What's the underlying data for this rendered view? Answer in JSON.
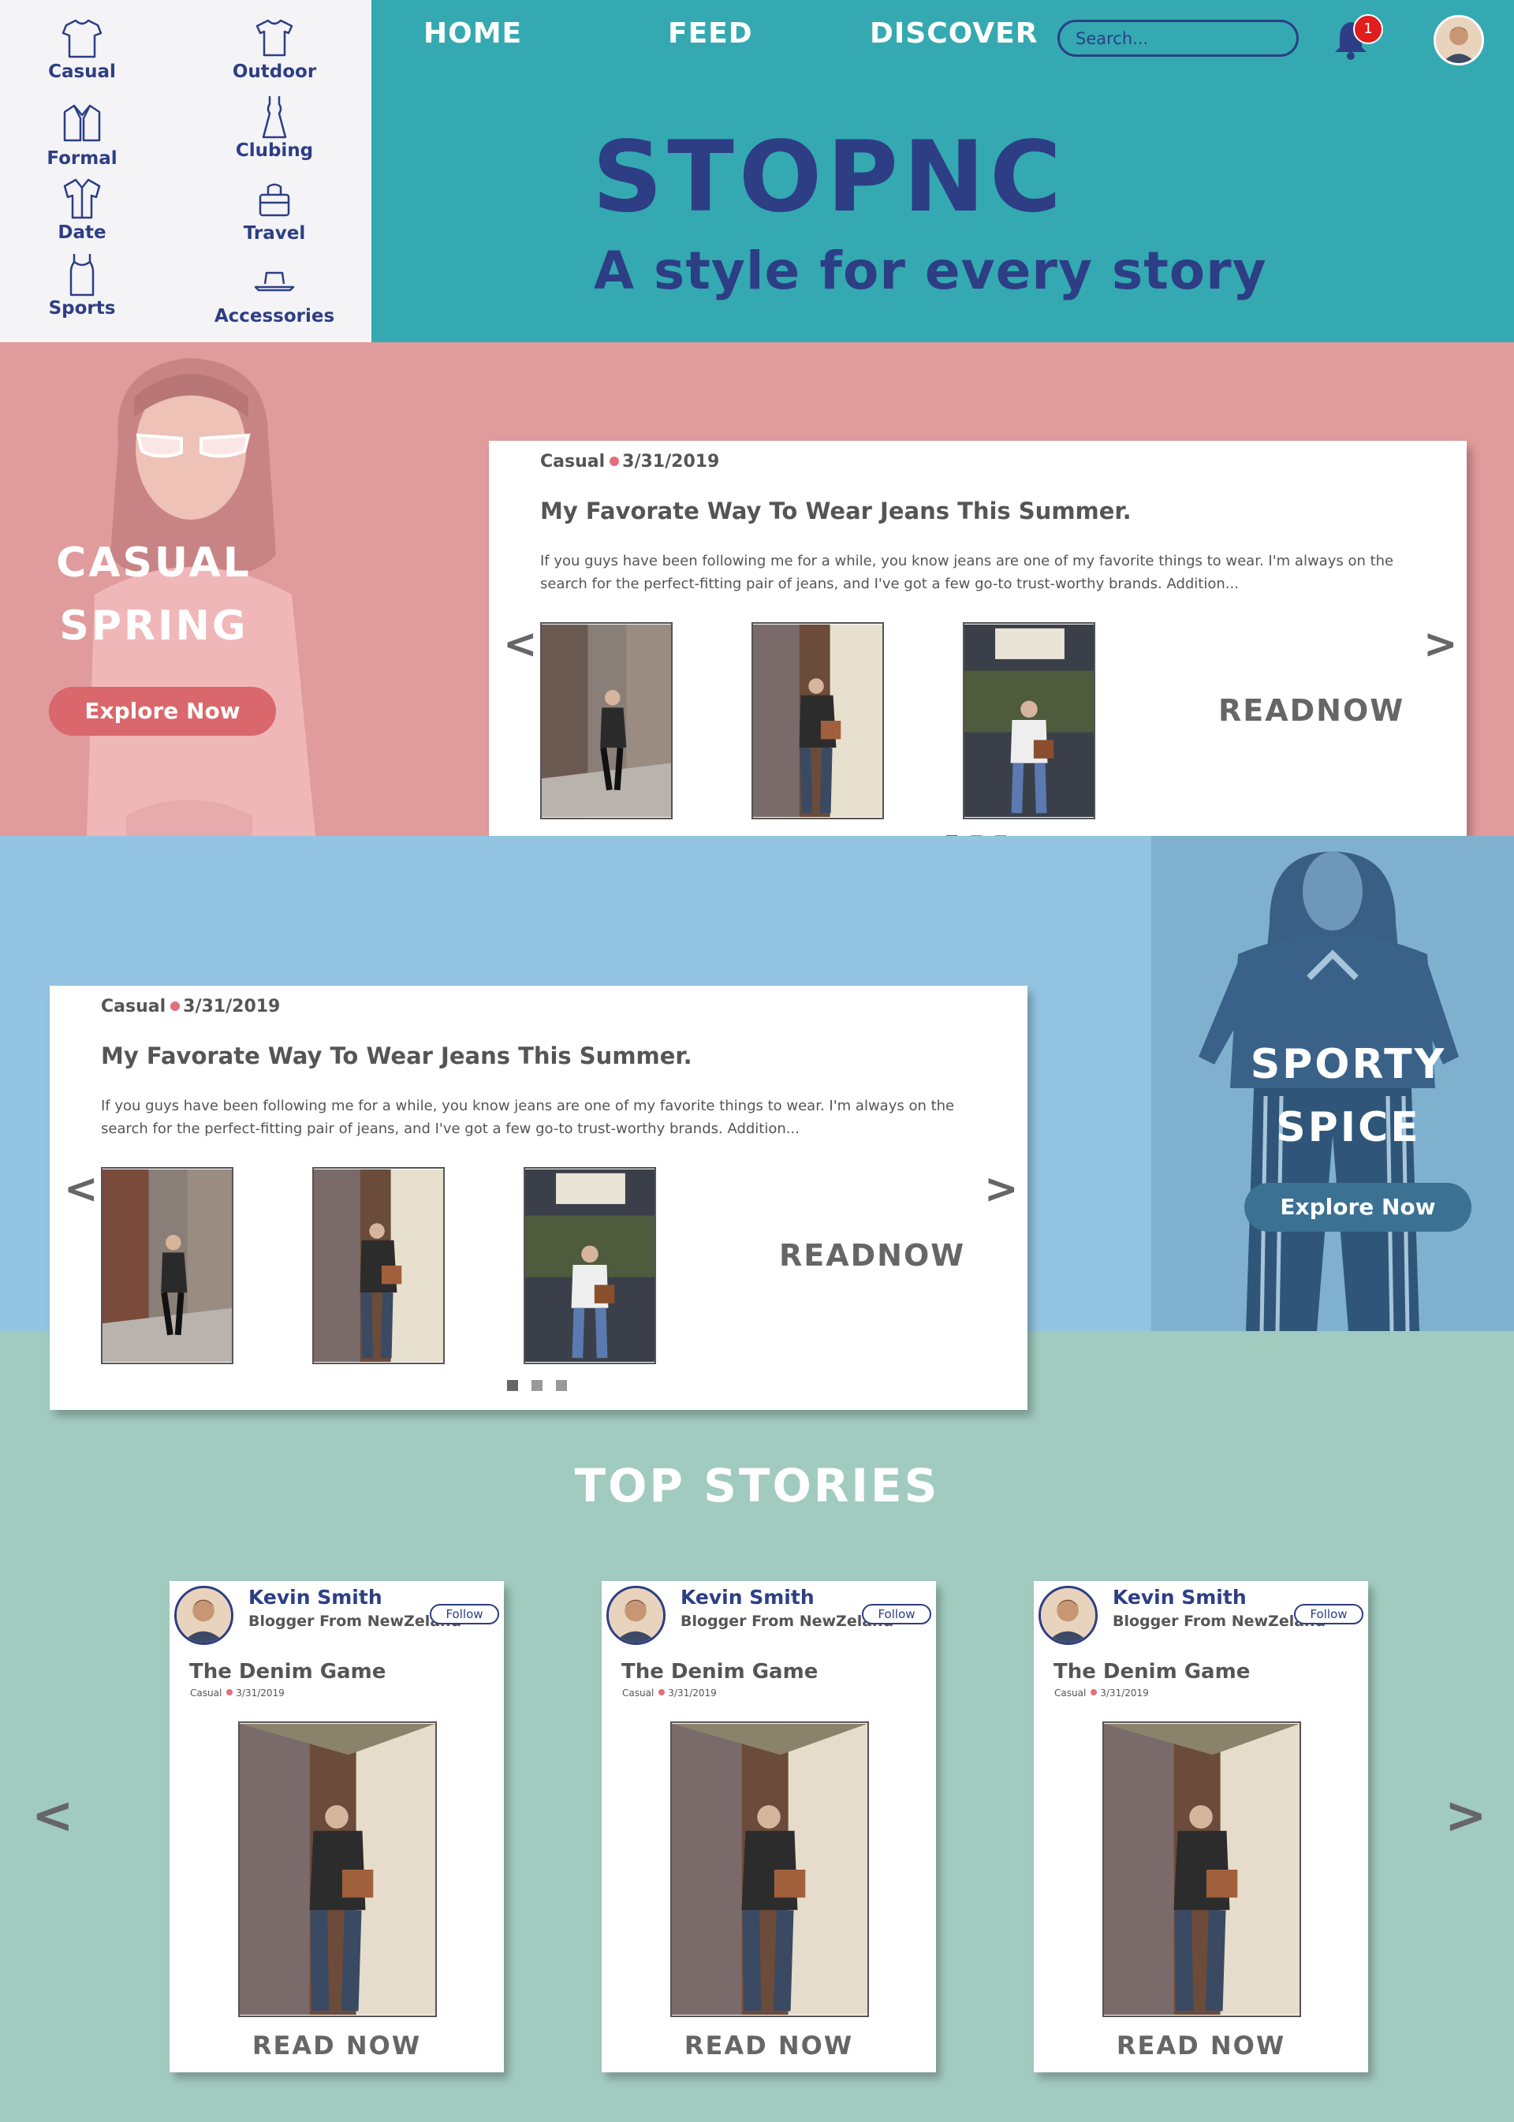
{
  "categories": [
    {
      "label": "Casual",
      "icon": "tshirt-icon"
    },
    {
      "label": "Outdoor",
      "icon": "shirt-icon"
    },
    {
      "label": "Formal",
      "icon": "jacket-icon"
    },
    {
      "label": "Clubing",
      "icon": "dress-icon"
    },
    {
      "label": "Date",
      "icon": "button-shirt-icon"
    },
    {
      "label": "Travel",
      "icon": "bag-icon"
    },
    {
      "label": "Sports",
      "icon": "tank-top-icon"
    },
    {
      "label": "Accessories",
      "icon": "hat-icon"
    }
  ],
  "nav": {
    "home": "HOME",
    "feed": "FEED",
    "discover": "DISCOVER",
    "search_placeholder": "Search...",
    "notification_count": "1"
  },
  "brand": {
    "name": "STOPNC",
    "tagline": "A style for every story"
  },
  "sections": [
    {
      "hero_line1": "CASUAL",
      "hero_line2": "SPRING",
      "explore_label": "Explore Now",
      "accent": "#e09b9c",
      "button_color": "#d9676b",
      "post": {
        "category": "Casual",
        "date": "3/31/2019",
        "title": "My Favorate Way To Wear Jeans This Summer.",
        "excerpt": "If you guys have been following me for a while, you know jeans are one of my favorite things to wear. I'm always on the search for the perfect-fitting pair of jeans, and I've got a few go-to trust-worthy brands. Addition...",
        "read_label": "READNOW",
        "prev_arrow": "<",
        "next_arrow": ">"
      }
    },
    {
      "hero_line1": "SPORTY",
      "hero_line2": "SPICE",
      "explore_label": "Explore Now",
      "accent": "#93c4e1",
      "button_color": "#3b7193",
      "post": {
        "category": "Casual",
        "date": "3/31/2019",
        "title": "My Favorate Way To Wear Jeans This Summer.",
        "excerpt": "If you guys have been following me for a while, you know jeans are one of my favorite things to wear. I'm always on the search for the perfect-fitting pair of jeans, and I've got a few go-to trust-worthy brands. Addition...",
        "read_label": "READNOW",
        "prev_arrow": "<",
        "next_arrow": ">"
      }
    }
  ],
  "top_stories": {
    "title": "TOP STORIES",
    "prev_arrow": "<",
    "next_arrow": ">",
    "cards": [
      {
        "author": "Kevin Smith",
        "role": "Blogger From NewZeland",
        "follow_label": "Follow",
        "title": "The Denim Game",
        "category": "Casual",
        "date": "3/31/2019",
        "read_label": "READ NOW"
      },
      {
        "author": "Kevin Smith",
        "role": "Blogger From NewZeland",
        "follow_label": "Follow",
        "title": "The Denim Game",
        "category": "Casual",
        "date": "3/31/2019",
        "read_label": "READ NOW"
      },
      {
        "author": "Kevin Smith",
        "role": "Blogger From NewZeland",
        "follow_label": "Follow",
        "title": "The Denim Game",
        "category": "Casual",
        "date": "3/31/2019",
        "read_label": "READ NOW"
      }
    ]
  },
  "colors": {
    "navy": "#2d3e85",
    "teal": "#34a9b1",
    "mint": "#a2cbbf",
    "notification_red": "#e01e1e"
  }
}
